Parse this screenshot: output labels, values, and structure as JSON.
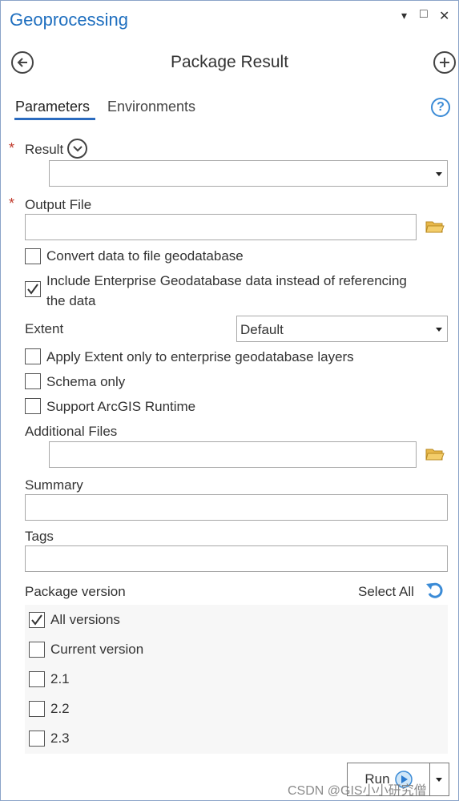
{
  "pane": {
    "title": "Geoprocessing",
    "controls": {
      "dropdown": "▾",
      "restore": "□",
      "close": "✕"
    }
  },
  "tool": {
    "title": "Package Result",
    "back_icon": "back-arrow-icon",
    "add_icon": "add-circle-icon"
  },
  "tabs": [
    {
      "label": "Parameters",
      "active": true
    },
    {
      "label": "Environments",
      "active": false
    }
  ],
  "help_label": "?",
  "params": {
    "result": {
      "label": "Result",
      "required": true,
      "required_mark": "*",
      "value": ""
    },
    "output_file": {
      "label": "Output File",
      "required": true,
      "required_mark": "*",
      "value": ""
    },
    "convert_data": {
      "label": "Convert data to file geodatabase",
      "checked": false
    },
    "include_enterprise": {
      "label_line1": "Include Enterprise Geodatabase data instead of referencing",
      "label_line2": "the data",
      "checked": true
    },
    "extent": {
      "label": "Extent",
      "value": "Default"
    },
    "apply_extent": {
      "label": "Apply Extent only to enterprise geodatabase layers",
      "checked": false
    },
    "schema_only": {
      "label": "Schema only",
      "checked": false
    },
    "support_runtime": {
      "label": "Support ArcGIS Runtime",
      "checked": false
    },
    "additional_files": {
      "label": "Additional Files",
      "value": ""
    },
    "summary": {
      "label": "Summary",
      "value": ""
    },
    "tags": {
      "label": "Tags",
      "value": ""
    },
    "package_version": {
      "label": "Package version",
      "select_all": "Select All",
      "options": [
        {
          "label": "All versions",
          "checked": true
        },
        {
          "label": "Current version",
          "checked": false
        },
        {
          "label": "2.1",
          "checked": false
        },
        {
          "label": "2.2",
          "checked": false
        },
        {
          "label": "2.3",
          "checked": false
        }
      ]
    }
  },
  "run_button": {
    "label": "Run"
  },
  "watermark": "CSDN @GIS小小研究僧",
  "colors": {
    "accent": "#1f6fbf",
    "required": "#c0392b",
    "folder": "#e8b84a"
  }
}
